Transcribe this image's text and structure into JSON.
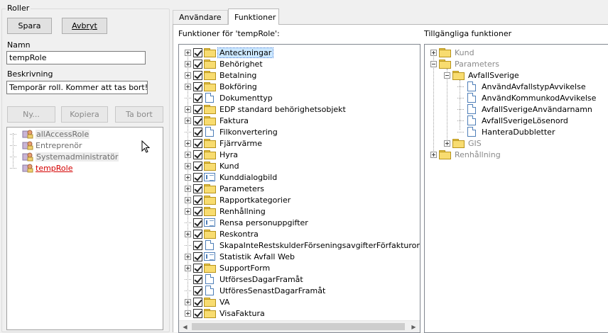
{
  "roles_group": {
    "title": "Roller",
    "save_label": "Spara",
    "cancel_label": "Avbryt",
    "name_label": "Namn",
    "name_value": "tempRole",
    "description_label": "Beskrivning",
    "description_value": "Temporär roll. Kommer att tas bort!",
    "new_label": "Ny...",
    "copy_label": "Kopiera",
    "delete_label": "Ta bort",
    "roles": [
      {
        "label": "allAccessRole"
      },
      {
        "label": "Entreprenör"
      },
      {
        "label": "Systemadministratör"
      },
      {
        "label": "tempRole"
      }
    ]
  },
  "tabs": [
    {
      "label": "Användare"
    },
    {
      "label": "Funktioner"
    }
  ],
  "functions_panel": {
    "assigned_label": "Funktioner för 'tempRole':",
    "available_label": "Tillgängliga funktioner",
    "assigned": [
      {
        "label": "Anteckningar"
      },
      {
        "label": "Behörighet"
      },
      {
        "label": "Betalning"
      },
      {
        "label": "Bokföring"
      },
      {
        "label": "Dokumenttyp"
      },
      {
        "label": "EDP standard behörighetsobjekt"
      },
      {
        "label": "Faktura"
      },
      {
        "label": "Filkonvertering"
      },
      {
        "label": "Fjärrvärme"
      },
      {
        "label": "Hyra"
      },
      {
        "label": "Kund"
      },
      {
        "label": "Kunddialogbild"
      },
      {
        "label": "Parameters"
      },
      {
        "label": "Rapportkategorier"
      },
      {
        "label": "Renhållning"
      },
      {
        "label": "Rensa personuppgifter"
      },
      {
        "label": "Reskontra"
      },
      {
        "label": "SkapaInteRestskulderFörseningsavgifterFörfakturormedKrav"
      },
      {
        "label": "Statistik Avfall Web"
      },
      {
        "label": "SupportForm"
      },
      {
        "label": "UtförsesDagarFramåt"
      },
      {
        "label": "UtföresSenastDagarFramåt"
      },
      {
        "label": "VA"
      },
      {
        "label": "VisaFaktura"
      }
    ],
    "available": [
      {
        "label": "Kund"
      },
      {
        "label": "Parameters"
      },
      {
        "label": "AvfallSverige"
      },
      {
        "label": "AnvändAvfallstypAvvikelse"
      },
      {
        "label": "AnvändKommunkodAvvikelse"
      },
      {
        "label": "AvfallSverigeAnvändarnamn"
      },
      {
        "label": "AvfallSverigeLösenord"
      },
      {
        "label": "HanteraDubbletter"
      },
      {
        "label": "GIS"
      },
      {
        "label": "Renhållning"
      }
    ]
  }
}
